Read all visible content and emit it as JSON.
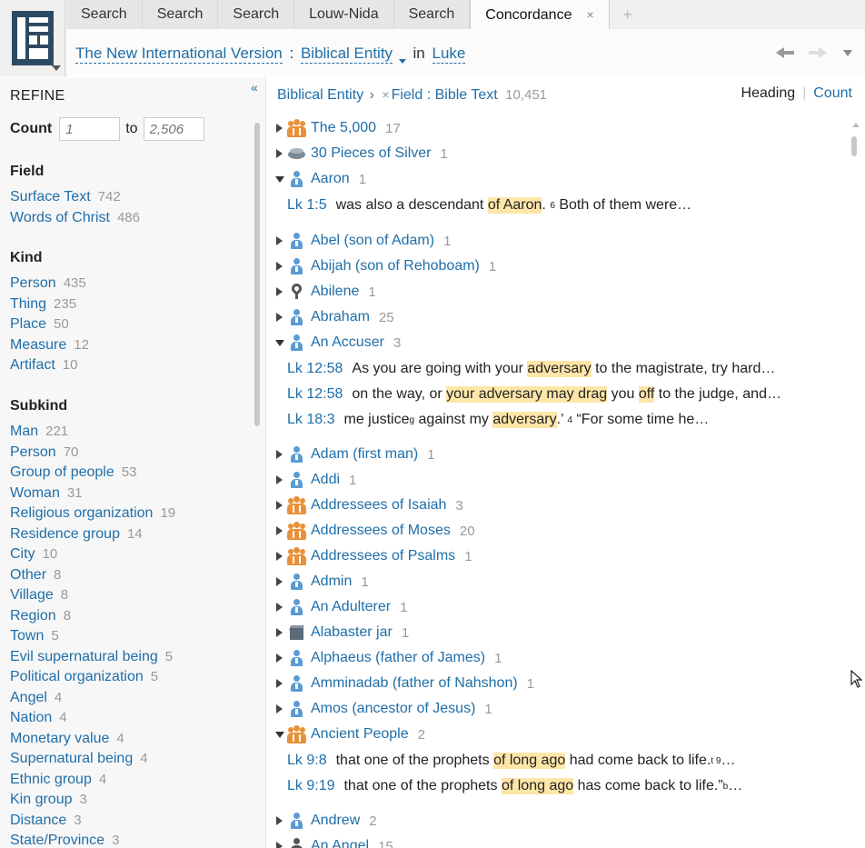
{
  "tabs": [
    {
      "label": "Search"
    },
    {
      "label": "Search"
    },
    {
      "label": "Search"
    },
    {
      "label": "Louw-Nida"
    },
    {
      "label": "Search"
    },
    {
      "label": "Concordance",
      "close": "×"
    }
  ],
  "tab_add": "+",
  "breadcrumb": {
    "version": "The New International Version",
    "colon": ":",
    "type": "Biblical Entity",
    "in": "in",
    "book": "Luke"
  },
  "refine": {
    "collapse": "«",
    "title": "REFINE",
    "count_label": "Count",
    "count_min_placeholder": "1",
    "count_to": "to",
    "count_max_placeholder": "2,506",
    "groups": [
      {
        "heading": "Field",
        "items": [
          {
            "label": "Surface Text",
            "count": "742"
          },
          {
            "label": "Words of Christ",
            "count": "486"
          }
        ]
      },
      {
        "heading": "Kind",
        "items": [
          {
            "label": "Person",
            "count": "435"
          },
          {
            "label": "Thing",
            "count": "235"
          },
          {
            "label": "Place",
            "count": "50"
          },
          {
            "label": "Measure",
            "count": "12"
          },
          {
            "label": "Artifact",
            "count": "10"
          }
        ]
      },
      {
        "heading": "Subkind",
        "items": [
          {
            "label": "Man",
            "count": "221"
          },
          {
            "label": "Person",
            "count": "70"
          },
          {
            "label": "Group of people",
            "count": "53"
          },
          {
            "label": "Woman",
            "count": "31"
          },
          {
            "label": "Religious organization",
            "count": "19"
          },
          {
            "label": "Residence group",
            "count": "14"
          },
          {
            "label": "City",
            "count": "10"
          },
          {
            "label": "Other",
            "count": "8"
          },
          {
            "label": "Village",
            "count": "8"
          },
          {
            "label": "Region",
            "count": "8"
          },
          {
            "label": "Town",
            "count": "5"
          },
          {
            "label": "Evil supernatural being",
            "count": "5"
          },
          {
            "label": "Political organization",
            "count": "5"
          },
          {
            "label": "Angel",
            "count": "4"
          },
          {
            "label": "Nation",
            "count": "4"
          },
          {
            "label": "Monetary value",
            "count": "4"
          },
          {
            "label": "Supernatural being",
            "count": "4"
          },
          {
            "label": "Ethnic group",
            "count": "4"
          },
          {
            "label": "Kin group",
            "count": "3"
          },
          {
            "label": "Distance",
            "count": "3"
          },
          {
            "label": "State/Province",
            "count": "3"
          }
        ]
      }
    ]
  },
  "results_header": {
    "entity": "Biblical Entity",
    "chevron": "›",
    "remove": "×",
    "field": "Field : Bible Text",
    "total": "10,451",
    "sort_heading": "Heading",
    "sort_divider": "|",
    "sort_count": "Count"
  },
  "entries": [
    {
      "name": "The 5,000",
      "count": "17",
      "icon": "group-icon",
      "expanded": false
    },
    {
      "name": "30 Pieces of Silver",
      "count": "1",
      "icon": "coin-icon",
      "expanded": false
    },
    {
      "name": "Aaron",
      "count": "1",
      "icon": "person-icon",
      "expanded": true
    },
    {
      "name": "Abel (son of Adam)",
      "count": "1",
      "icon": "person-icon",
      "expanded": false
    },
    {
      "name": "Abijah (son of Rehoboam)",
      "count": "1",
      "icon": "person-icon",
      "expanded": false
    },
    {
      "name": "Abilene",
      "count": "1",
      "icon": "place-icon",
      "expanded": false
    },
    {
      "name": "Abraham",
      "count": "25",
      "icon": "person-icon",
      "expanded": false
    },
    {
      "name": "An Accuser",
      "count": "3",
      "icon": "person-icon",
      "expanded": true
    },
    {
      "name": "Adam (first man)",
      "count": "1",
      "icon": "person-icon",
      "expanded": false
    },
    {
      "name": "Addi",
      "count": "1",
      "icon": "person-icon",
      "expanded": false
    },
    {
      "name": "Addressees of Isaiah",
      "count": "3",
      "icon": "group-icon",
      "expanded": false
    },
    {
      "name": "Addressees of Moses",
      "count": "20",
      "icon": "group-icon",
      "expanded": false
    },
    {
      "name": "Addressees of Psalms",
      "count": "1",
      "icon": "group-icon",
      "expanded": false
    },
    {
      "name": "Admin",
      "count": "1",
      "icon": "person-icon",
      "expanded": false
    },
    {
      "name": "An Adulterer",
      "count": "1",
      "icon": "person-icon",
      "expanded": false
    },
    {
      "name": "Alabaster jar",
      "count": "1",
      "icon": "box-icon",
      "expanded": false
    },
    {
      "name": "Alphaeus (father of James)",
      "count": "1",
      "icon": "person-icon",
      "expanded": false
    },
    {
      "name": "Amminadab (father of Nahshon)",
      "count": "1",
      "icon": "person-icon",
      "expanded": false
    },
    {
      "name": "Amos (ancestor of Jesus)",
      "count": "1",
      "icon": "person-icon",
      "expanded": false
    },
    {
      "name": "Ancient People",
      "count": "2",
      "icon": "group-icon",
      "expanded": true
    },
    {
      "name": "Andrew",
      "count": "2",
      "icon": "person-icon",
      "expanded": false
    },
    {
      "name": "An Angel",
      "count": "15",
      "icon": "angel-icon",
      "expanded": false
    }
  ],
  "hits": {
    "aaron": [
      {
        "ref": "Lk 1:5",
        "pre": "was also a descendant ",
        "hl": "of Aaron",
        "post": ". ",
        "sup": "6",
        "tail": " Both of them were…"
      }
    ],
    "accuser": [
      {
        "ref": "Lk 12:58",
        "a": "As you are going with your ",
        "h1": "adversary",
        "b": " to the magistrate, try hard…"
      },
      {
        "ref": "Lk 12:58",
        "a": "on the way, or ",
        "h1": "your adversary may drag",
        "b": " you ",
        "h2": "off",
        "c": " to the judge, and…"
      },
      {
        "ref": "Lk 18:3",
        "a": "me justice",
        "sup": "g",
        "b": " against my ",
        "h1": "adversary",
        "c": ".’ ",
        "sup2": "4",
        "d": " “For some time he…"
      }
    ],
    "ancient": [
      {
        "ref": "Lk 9:8",
        "a": "that one of the prophets ",
        "h1": "of long ago",
        "b": " had come back to life.",
        "sup": "t 9",
        "c": "…"
      },
      {
        "ref": "Lk 9:19",
        "a": "that one of the prophets ",
        "h1": "of long ago",
        "b": " has come back to life.”",
        "sup": "b",
        "c": "…"
      }
    ]
  }
}
